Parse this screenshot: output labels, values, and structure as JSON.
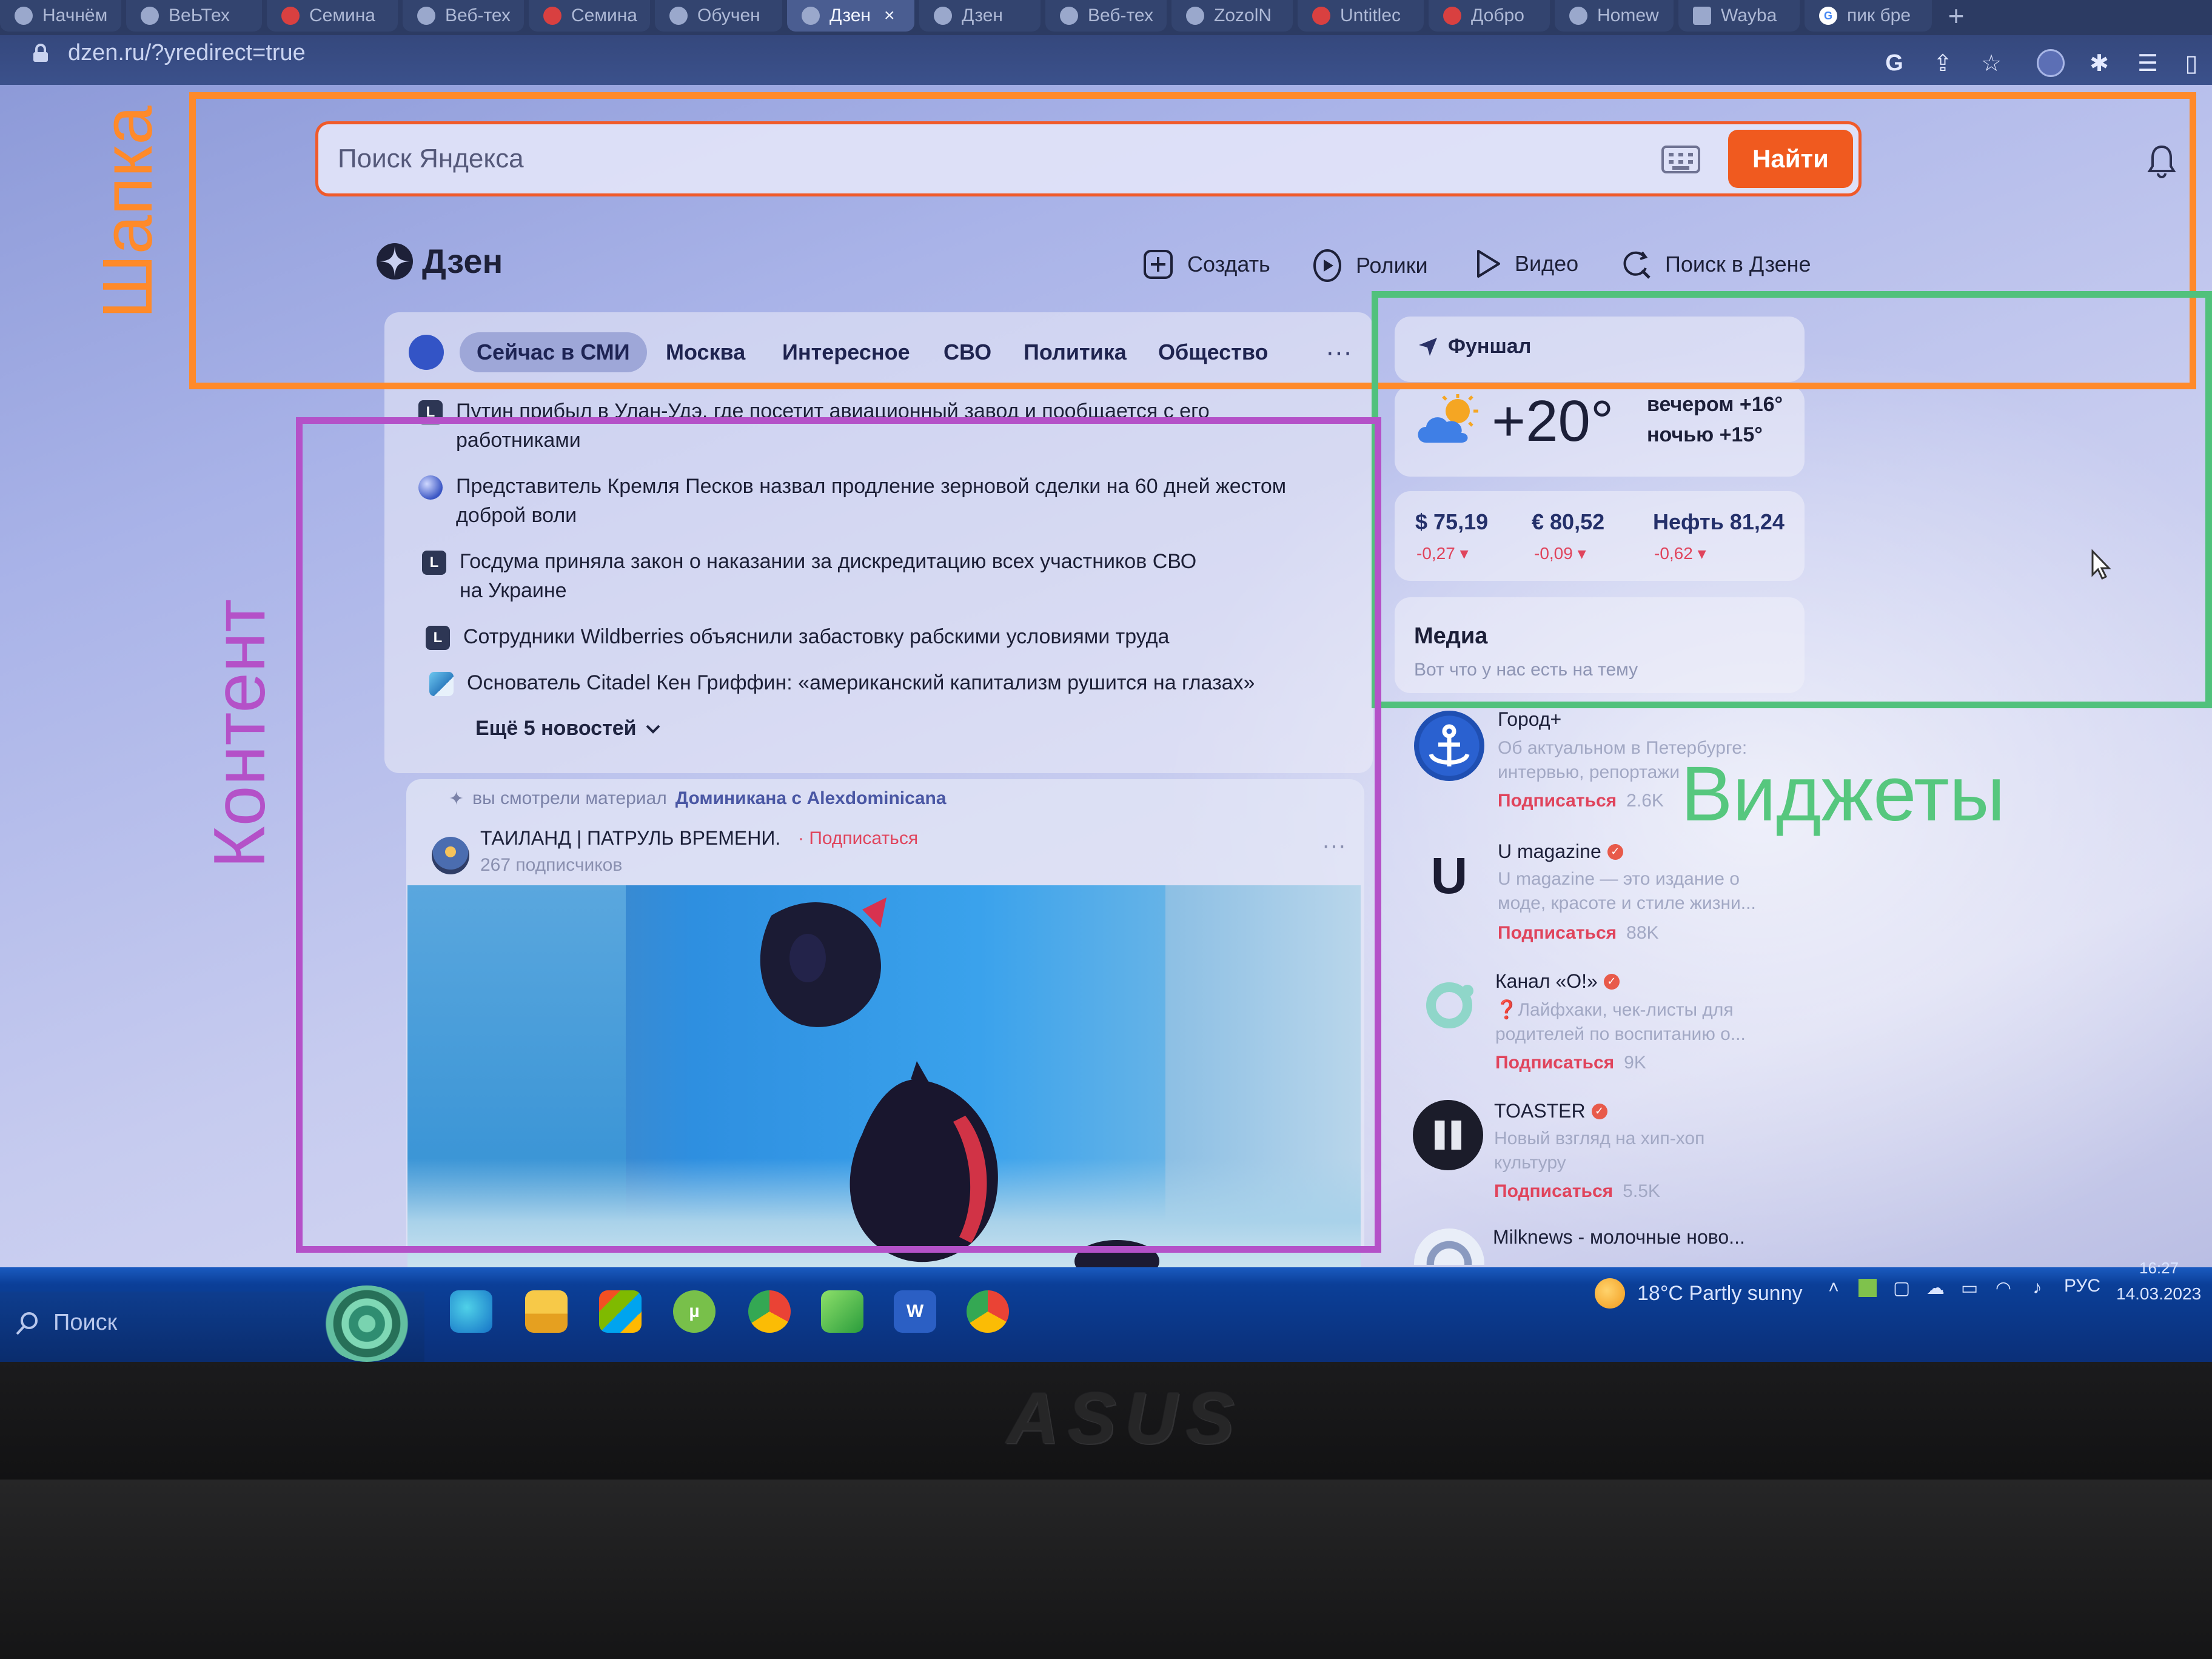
{
  "browser": {
    "tabs": [
      {
        "label": "Начнём",
        "active": false
      },
      {
        "label": "ВеЬТех",
        "active": false
      },
      {
        "label": "Семина",
        "active": false
      },
      {
        "label": "Веб-тех",
        "active": false
      },
      {
        "label": "Семина",
        "active": false
      },
      {
        "label": "Обучен",
        "active": false
      },
      {
        "label": "Дзен",
        "close": "×",
        "active": true
      },
      {
        "label": "Дзен",
        "active": false
      },
      {
        "label": "Веб-тех",
        "active": false
      },
      {
        "label": "ZozolN",
        "active": false
      },
      {
        "label": "Untitlec",
        "active": false
      },
      {
        "label": "Добро",
        "active": false
      },
      {
        "label": "Homew",
        "active": false
      },
      {
        "label": "Wayba",
        "active": false
      },
      {
        "label": "пик бре",
        "active": false
      }
    ],
    "new_tab": "+",
    "url": "dzen.ru/?yredirect=true",
    "icons": [
      "google-lens-icon",
      "share-icon",
      "bookmark-star-icon",
      "profile-icon",
      "extensions-icon",
      "reading-list-icon",
      "side-panel-icon"
    ]
  },
  "header": {
    "search_placeholder": "Поиск Яндекса",
    "find_label": "Найти",
    "logo_text": "Дзен",
    "nav": [
      {
        "label": "Создать",
        "icon": "plus-square-icon"
      },
      {
        "label": "Ролики",
        "icon": "clips-icon"
      },
      {
        "label": "Видео",
        "icon": "play-icon"
      },
      {
        "label": "Поиск в Дзене",
        "icon": "search-refresh-icon"
      }
    ]
  },
  "content": {
    "tabs": [
      "Сейчас в СМИ",
      "Москва",
      "Интересное",
      "СВО",
      "Политика",
      "Общество"
    ],
    "tabs_more": "···",
    "news": [
      {
        "badge": "L",
        "kind": "mono",
        "line1": "Путин прибыл в Улан-Удэ, где посетит авиационный завод и пообщается с его",
        "line2": "работниками"
      },
      {
        "badge": "",
        "kind": "globe",
        "line1": "Представитель Кремля Песков назвал продление зерновой сделки на 60 дней жестом",
        "line2": "доброй воли"
      },
      {
        "badge": "L",
        "kind": "mono",
        "line1": "Госдума приняла закон о наказании за дискредитацию всех участников СВО",
        "line2": "на Украине"
      },
      {
        "badge": "L",
        "kind": "mono",
        "line1": "Сотрудники Wildberries объяснили забастовку рабскими условиями труда",
        "line2": ""
      },
      {
        "badge": "",
        "kind": "photo",
        "line1": "Основатель Citadel Кен Гриффин: «американский капитализм рушится на глазах»",
        "line2": ""
      }
    ],
    "more_news": "Ещё 5 новостей",
    "feed": {
      "seen_prefix": "вы смотрели материал",
      "seen_title": "Доминикана с Alexdominicana",
      "channel_name": "ТАИЛАНД | ПАТРУЛЬ ВРЕМЕНИ.",
      "subscribe": "· Подписаться",
      "subscribers": "267 подписчиков",
      "menu": "···"
    }
  },
  "widgets": {
    "city": "Фуншал",
    "temperature": "+20°",
    "evening": "вечером +16°",
    "night": "ночью +15°",
    "rates": [
      {
        "label": "$ 75,19",
        "delta": "-0,27 ▾"
      },
      {
        "label": "€ 80,52",
        "delta": "-0,09 ▾"
      },
      {
        "label": "Нефть 81,24",
        "delta": "-0,62 ▾"
      }
    ],
    "media_title": "Медиа",
    "media_sub": "Вот что у нас есть на тему",
    "channels": [
      {
        "name": "Город+",
        "verified": false,
        "desc1": "Об актуальном в Петербурге:",
        "desc2": "интервью, репортажи",
        "subscribe": "Подписаться",
        "count": "2.6K"
      },
      {
        "name": "U magazine",
        "verified": true,
        "desc1": "U magazine — это издание о",
        "desc2": "моде, красоте и стиле жизни...",
        "subscribe": "Подписаться",
        "count": "88K"
      },
      {
        "name": "Канал «О!»",
        "verified": true,
        "desc1": "❓Лайфхаки, чек-листы для",
        "desc2": "родителей по воспитанию о...",
        "subscribe": "Подписаться",
        "count": "9K"
      },
      {
        "name": "TOASTER",
        "verified": true,
        "desc1": "Новый взгляд на хип-хоп",
        "desc2": "культуру",
        "subscribe": "Подписаться",
        "count": "5.5K"
      },
      {
        "name": "Milknews - молочные ново...",
        "verified": false,
        "desc1": "",
        "desc2": "",
        "subscribe": "",
        "count": ""
      }
    ]
  },
  "annotations": {
    "header": "Шапка",
    "content": "Контент",
    "widgets": "Виджеты",
    "colors": {
      "header": "#ff8a2a",
      "content": "#b451c8",
      "widgets": "#51c17c"
    }
  },
  "taskbar": {
    "search": "Поиск",
    "weather": "18°C  Partly sunny",
    "lang": "РУС",
    "time": "16:27",
    "date": "14.03.2023",
    "apps": [
      "edge-icon",
      "file-explorer-icon",
      "store-icon",
      "utorrent-icon",
      "chrome-icon",
      "game-icon",
      "word-icon",
      "chrome-profile-icon"
    ]
  },
  "laptop": {
    "brand": "ASUS"
  }
}
